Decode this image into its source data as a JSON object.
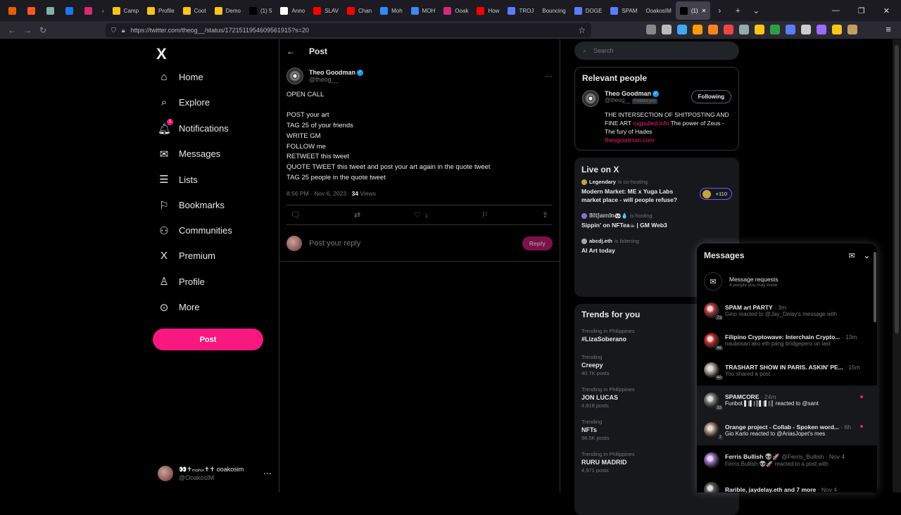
{
  "browser": {
    "tabs": [
      {
        "label": "",
        "color": "#e66000",
        "pinned": true
      },
      {
        "label": "",
        "color": "#ff5722",
        "pinned": true
      },
      {
        "label": "",
        "color": "#7fb2a3",
        "pinned": true
      },
      {
        "label": "",
        "color": "#1877f2",
        "pinned": true
      },
      {
        "label": "",
        "color": "#d62976",
        "pinned": true
      },
      {
        "label": "‹",
        "color": "",
        "pinned": false
      },
      {
        "label": "Camp",
        "color": "#f5c518",
        "pinned": false
      },
      {
        "label": "Profile",
        "color": "#f5c518",
        "pinned": false
      },
      {
        "label": "Coot",
        "color": "#f5c518",
        "pinned": false
      },
      {
        "label": "Demo",
        "color": "#f5c518",
        "pinned": false
      },
      {
        "label": "(1) 5",
        "color": "#000000",
        "pinned": false
      },
      {
        "label": "Anno",
        "color": "#ffffff",
        "pinned": false
      },
      {
        "label": "SLAV",
        "color": "#ff0000",
        "pinned": false
      },
      {
        "label": "Chan",
        "color": "#ff0000",
        "pinned": false
      },
      {
        "label": "Moh",
        "color": "#2e8bff",
        "pinned": false
      },
      {
        "label": "MOH",
        "color": "#4285f4",
        "pinned": false
      },
      {
        "label": "Ooak",
        "color": "#d62976",
        "pinned": false
      },
      {
        "label": "How",
        "color": "#ff0000",
        "pinned": false
      },
      {
        "label": "TROJ",
        "color": "#5b7cfa",
        "pinned": false
      },
      {
        "label": "Bouncing",
        "color": "",
        "pinned": false
      },
      {
        "label": "DOGE",
        "color": "#5b7cfa",
        "pinned": false
      },
      {
        "label": "SPAM",
        "color": "#5b7cfa",
        "pinned": false
      },
      {
        "label": "OoakosIM",
        "color": "",
        "pinned": false
      },
      {
        "label": "(1)",
        "color": "#000000",
        "pinned": false,
        "active": true
      }
    ],
    "tab_controls": [
      "›",
      "+",
      "⌄"
    ],
    "url": "https://twitter.com/theog__/status/1721511954609561915?s=20",
    "extension_colors": [
      "#888888",
      "#bbbbbb",
      "#3fa9f5",
      "#ff9900",
      "#f6851b",
      "#e44",
      "#9aa",
      "#f5c518",
      "#2ea043",
      "#5b7cfa",
      "#cccccc",
      "#9b6bff",
      "#f5c518",
      "#c0a060"
    ]
  },
  "nav": {
    "logo": "X",
    "items": [
      {
        "label": "Home",
        "icon": "⌂",
        "name": "home"
      },
      {
        "label": "Explore",
        "icon": "⌕",
        "name": "explore"
      },
      {
        "label": "Notifications",
        "icon": "🔔︎",
        "name": "notifications",
        "badge": "1"
      },
      {
        "label": "Messages",
        "icon": "✉",
        "name": "messages"
      },
      {
        "label": "Lists",
        "icon": "☰",
        "name": "lists"
      },
      {
        "label": "Bookmarks",
        "icon": "⚐",
        "name": "bookmarks"
      },
      {
        "label": "Communities",
        "icon": "⚇",
        "name": "communities"
      },
      {
        "label": "Premium",
        "icon": "X",
        "name": "premium"
      },
      {
        "label": "Profile",
        "icon": "♙",
        "name": "profile"
      },
      {
        "label": "More",
        "icon": "⊙",
        "name": "more"
      }
    ],
    "post_button": "Post",
    "account": {
      "display_name": "👀✝ₘₒₕᵢₛ✝✝ ooakosim",
      "handle": "@OoakosIM",
      "more": "⋯"
    }
  },
  "post_header": {
    "back": "←",
    "title": "Post"
  },
  "tweet": {
    "author": "Theo Goodman",
    "handle": "@theog__",
    "more": "⋯",
    "lines": [
      "OPEN CALL",
      "",
      "POST your art",
      "TAG 25 of your friends",
      "WRITE GM",
      "FOLLOW me",
      "RETWEET this tweet",
      "QUOTE TWEET this tweet and post your art again in the quote tweet",
      "TAG 25 people in the quote tweet"
    ],
    "time": "8:56 PM · Nov 6, 2023 · ",
    "views_count": "34",
    "views_label": " Views",
    "like_count": "1"
  },
  "reply": {
    "placeholder": "Post your reply",
    "button": "Reply"
  },
  "search": {
    "placeholder": "Search"
  },
  "relevant": {
    "title": "Relevant people",
    "name": "Theo Goodman",
    "handle": "@theog__",
    "follows_you": "Follows you",
    "button": "Following",
    "bio_1": "THE INTERSECTION OF SHITPOSTING AND FINE ART ",
    "bio_link": "rugpulled.info",
    "bio_2": " The power of Zeus - The fury of Hades",
    "site": "theogoodman.com"
  },
  "live": {
    "title": "Live on X",
    "items": [
      {
        "host": "Legendary",
        "status": " is co-hosting",
        "title": "Modern Market: ME x Yuga Labs market place - will people refuse?",
        "pill": "+110"
      },
      {
        "host": "𝔹𝕚𝕥𝕛𝕒𝕞𝕚𝕟🐼💧",
        "status": " is hosting",
        "title": "Sippin' on NFTea☕ | GM Web3"
      },
      {
        "host": "abcdj.eth",
        "status": " is listening",
        "title": "AI Art today"
      }
    ]
  },
  "trends": {
    "title": "Trends for you",
    "items": [
      {
        "context": "Trending in Philippines",
        "name": "#LizaSoberano",
        "count": ""
      },
      {
        "context": "Trending",
        "name": "Creepy",
        "count": "40.7K posts"
      },
      {
        "context": "Trending in Philippines",
        "name": "JON LUCAS",
        "count": "4,918 posts"
      },
      {
        "context": "Trending",
        "name": "NFTs",
        "count": "98.5K posts"
      },
      {
        "context": "Trending in Philippines",
        "name": "RURU MADRID",
        "count": "4,971 posts"
      }
    ]
  },
  "messages": {
    "title": "Messages",
    "requests_title": "Message requests",
    "requests_sub": "4 people you may know",
    "items": [
      {
        "name": "SPAM art PARTY",
        "time": " · 3m",
        "preview": "Gino reacted to @Jay_Delay's message with",
        "count": "73",
        "color": "#b33",
        "unread": false,
        "highlight": false,
        "bright": false
      },
      {
        "name": "Filipino Cryptowave: Interchain Crypto...",
        "time": " · 13m",
        "preview": "naubosan ako eth pang bridgepero un last",
        "count": "48",
        "color": "#c22",
        "unread": false,
        "highlight": false,
        "bright": false
      },
      {
        "name": "TRASHART SHOW IN PARIS. ASKIN' PE...",
        "time": " · 15m",
        "preview": "You shared a post",
        "count": "40",
        "color": "#a98",
        "unread": false,
        "highlight": false,
        "bright": false
      },
      {
        "name": "SPAMCORE",
        "time": " · 24m",
        "preview": "Funbot ▌|▌|║▌|▌|║ reacted to @sant",
        "count": "33",
        "color": "#777",
        "unread": true,
        "highlight": true,
        "bright": true
      },
      {
        "name": "Orange project - Collab - Spoken word...",
        "time": " · 6h",
        "preview": "Gio Karlo reacted to @AriasJopet's mes",
        "count": "7",
        "color": "#a87",
        "unread": true,
        "highlight": true,
        "bright": true
      },
      {
        "name": "Ferris Bullish 👽🚀",
        "time": " @Ferris_Bullish · Nov 4",
        "preview": "Ferris Bullish 👽🚀 reacted to a post with",
        "count": "",
        "color": "#96c",
        "unread": false,
        "highlight": false,
        "bright": false
      },
      {
        "name": "Rarible, jaydelay.eth and 7 more",
        "time": " · Nov 4",
        "preview": "",
        "count": "",
        "color": "#555",
        "unread": false,
        "highlight": false,
        "bright": false
      }
    ]
  }
}
